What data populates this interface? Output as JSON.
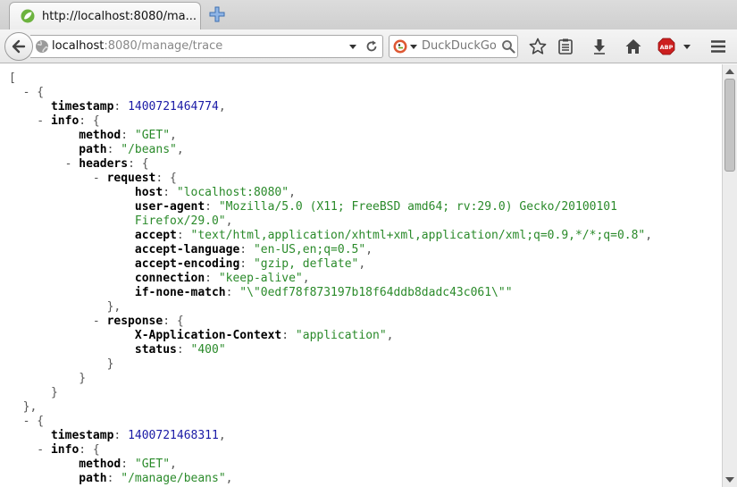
{
  "tab": {
    "title": "http://localhost:8080/ma..."
  },
  "urlbar": {
    "host": "localhost",
    "path": ":8080/manage/trace"
  },
  "search": {
    "placeholder": "DuckDuckGo"
  },
  "icons": {
    "favicon": "spring-leaf-icon",
    "new_tab": "plus-icon",
    "back": "back-arrow-icon",
    "site_identity": "globe-icon",
    "history_dropdown": "chevron-down-icon",
    "reload": "reload-icon",
    "search_engine": "duckduckgo-icon",
    "search_go": "magnifier-icon",
    "bookmark": "star-icon",
    "reading_list": "clipboard-icon",
    "downloads": "download-arrow-icon",
    "home": "home-icon",
    "adblock": "adblock-plus-icon",
    "menu": "hamburger-menu-icon"
  },
  "colors": {
    "json_string": "#2a8a2a",
    "json_number": "#1a1aa6",
    "adblock_red": "#cc1f1f"
  },
  "json_lines": [
    [
      [
        "t",
        "["
      ]
    ],
    [
      [
        "t",
        "  - {"
      ]
    ],
    [
      [
        "t",
        "      "
      ],
      [
        "k",
        "timestamp"
      ],
      [
        "t",
        ": "
      ],
      [
        "n",
        "1400721464774"
      ],
      [
        "t",
        ","
      ]
    ],
    [
      [
        "t",
        "    - "
      ],
      [
        "k",
        "info"
      ],
      [
        "t",
        ": {"
      ]
    ],
    [
      [
        "t",
        "          "
      ],
      [
        "k",
        "method"
      ],
      [
        "t",
        ": "
      ],
      [
        "s",
        "\"GET\""
      ],
      [
        "t",
        ","
      ]
    ],
    [
      [
        "t",
        "          "
      ],
      [
        "k",
        "path"
      ],
      [
        "t",
        ": "
      ],
      [
        "s",
        "\"/beans\""
      ],
      [
        "t",
        ","
      ]
    ],
    [
      [
        "t",
        "        - "
      ],
      [
        "k",
        "headers"
      ],
      [
        "t",
        ": {"
      ]
    ],
    [
      [
        "t",
        "            - "
      ],
      [
        "k",
        "request"
      ],
      [
        "t",
        ": {"
      ]
    ],
    [
      [
        "t",
        "                  "
      ],
      [
        "k",
        "host"
      ],
      [
        "t",
        ": "
      ],
      [
        "s",
        "\"localhost:8080\""
      ],
      [
        "t",
        ","
      ]
    ],
    [
      [
        "t",
        "                  "
      ],
      [
        "k",
        "user-agent"
      ],
      [
        "t",
        ": "
      ],
      [
        "s",
        "\"Mozilla/5.0 (X11; FreeBSD amd64; rv:29.0) Gecko/20100101"
      ]
    ],
    [
      [
        "t",
        "                  "
      ],
      [
        "s",
        "Firefox/29.0\""
      ],
      [
        "t",
        ","
      ]
    ],
    [
      [
        "t",
        "                  "
      ],
      [
        "k",
        "accept"
      ],
      [
        "t",
        ": "
      ],
      [
        "s",
        "\"text/html,application/xhtml+xml,application/xml;q=0.9,*/*;q=0.8\""
      ],
      [
        "t",
        ","
      ]
    ],
    [
      [
        "t",
        "                  "
      ],
      [
        "k",
        "accept-language"
      ],
      [
        "t",
        ": "
      ],
      [
        "s",
        "\"en-US,en;q=0.5\""
      ],
      [
        "t",
        ","
      ]
    ],
    [
      [
        "t",
        "                  "
      ],
      [
        "k",
        "accept-encoding"
      ],
      [
        "t",
        ": "
      ],
      [
        "s",
        "\"gzip, deflate\""
      ],
      [
        "t",
        ","
      ]
    ],
    [
      [
        "t",
        "                  "
      ],
      [
        "k",
        "connection"
      ],
      [
        "t",
        ": "
      ],
      [
        "s",
        "\"keep-alive\""
      ],
      [
        "t",
        ","
      ]
    ],
    [
      [
        "t",
        "                  "
      ],
      [
        "k",
        "if-none-match"
      ],
      [
        "t",
        ": "
      ],
      [
        "s",
        "\"\\\"0edf78f873197b18f64ddb8dadc43c061\\\"\""
      ]
    ],
    [
      [
        "t",
        "              },"
      ]
    ],
    [
      [
        "t",
        "            - "
      ],
      [
        "k",
        "response"
      ],
      [
        "t",
        ": {"
      ]
    ],
    [
      [
        "t",
        "                  "
      ],
      [
        "k",
        "X-Application-Context"
      ],
      [
        "t",
        ": "
      ],
      [
        "s",
        "\"application\""
      ],
      [
        "t",
        ","
      ]
    ],
    [
      [
        "t",
        "                  "
      ],
      [
        "k",
        "status"
      ],
      [
        "t",
        ": "
      ],
      [
        "s",
        "\"400\""
      ]
    ],
    [
      [
        "t",
        "              }"
      ]
    ],
    [
      [
        "t",
        "          }"
      ]
    ],
    [
      [
        "t",
        "      }"
      ]
    ],
    [
      [
        "t",
        "  },"
      ]
    ],
    [
      [
        "t",
        "  - {"
      ]
    ],
    [
      [
        "t",
        "      "
      ],
      [
        "k",
        "timestamp"
      ],
      [
        "t",
        ": "
      ],
      [
        "n",
        "1400721468311"
      ],
      [
        "t",
        ","
      ]
    ],
    [
      [
        "t",
        "    - "
      ],
      [
        "k",
        "info"
      ],
      [
        "t",
        ": {"
      ]
    ],
    [
      [
        "t",
        "          "
      ],
      [
        "k",
        "method"
      ],
      [
        "t",
        ": "
      ],
      [
        "s",
        "\"GET\""
      ],
      [
        "t",
        ","
      ]
    ],
    [
      [
        "t",
        "          "
      ],
      [
        "k",
        "path"
      ],
      [
        "t",
        ": "
      ],
      [
        "s",
        "\"/manage/beans\""
      ],
      [
        "t",
        ","
      ]
    ]
  ]
}
